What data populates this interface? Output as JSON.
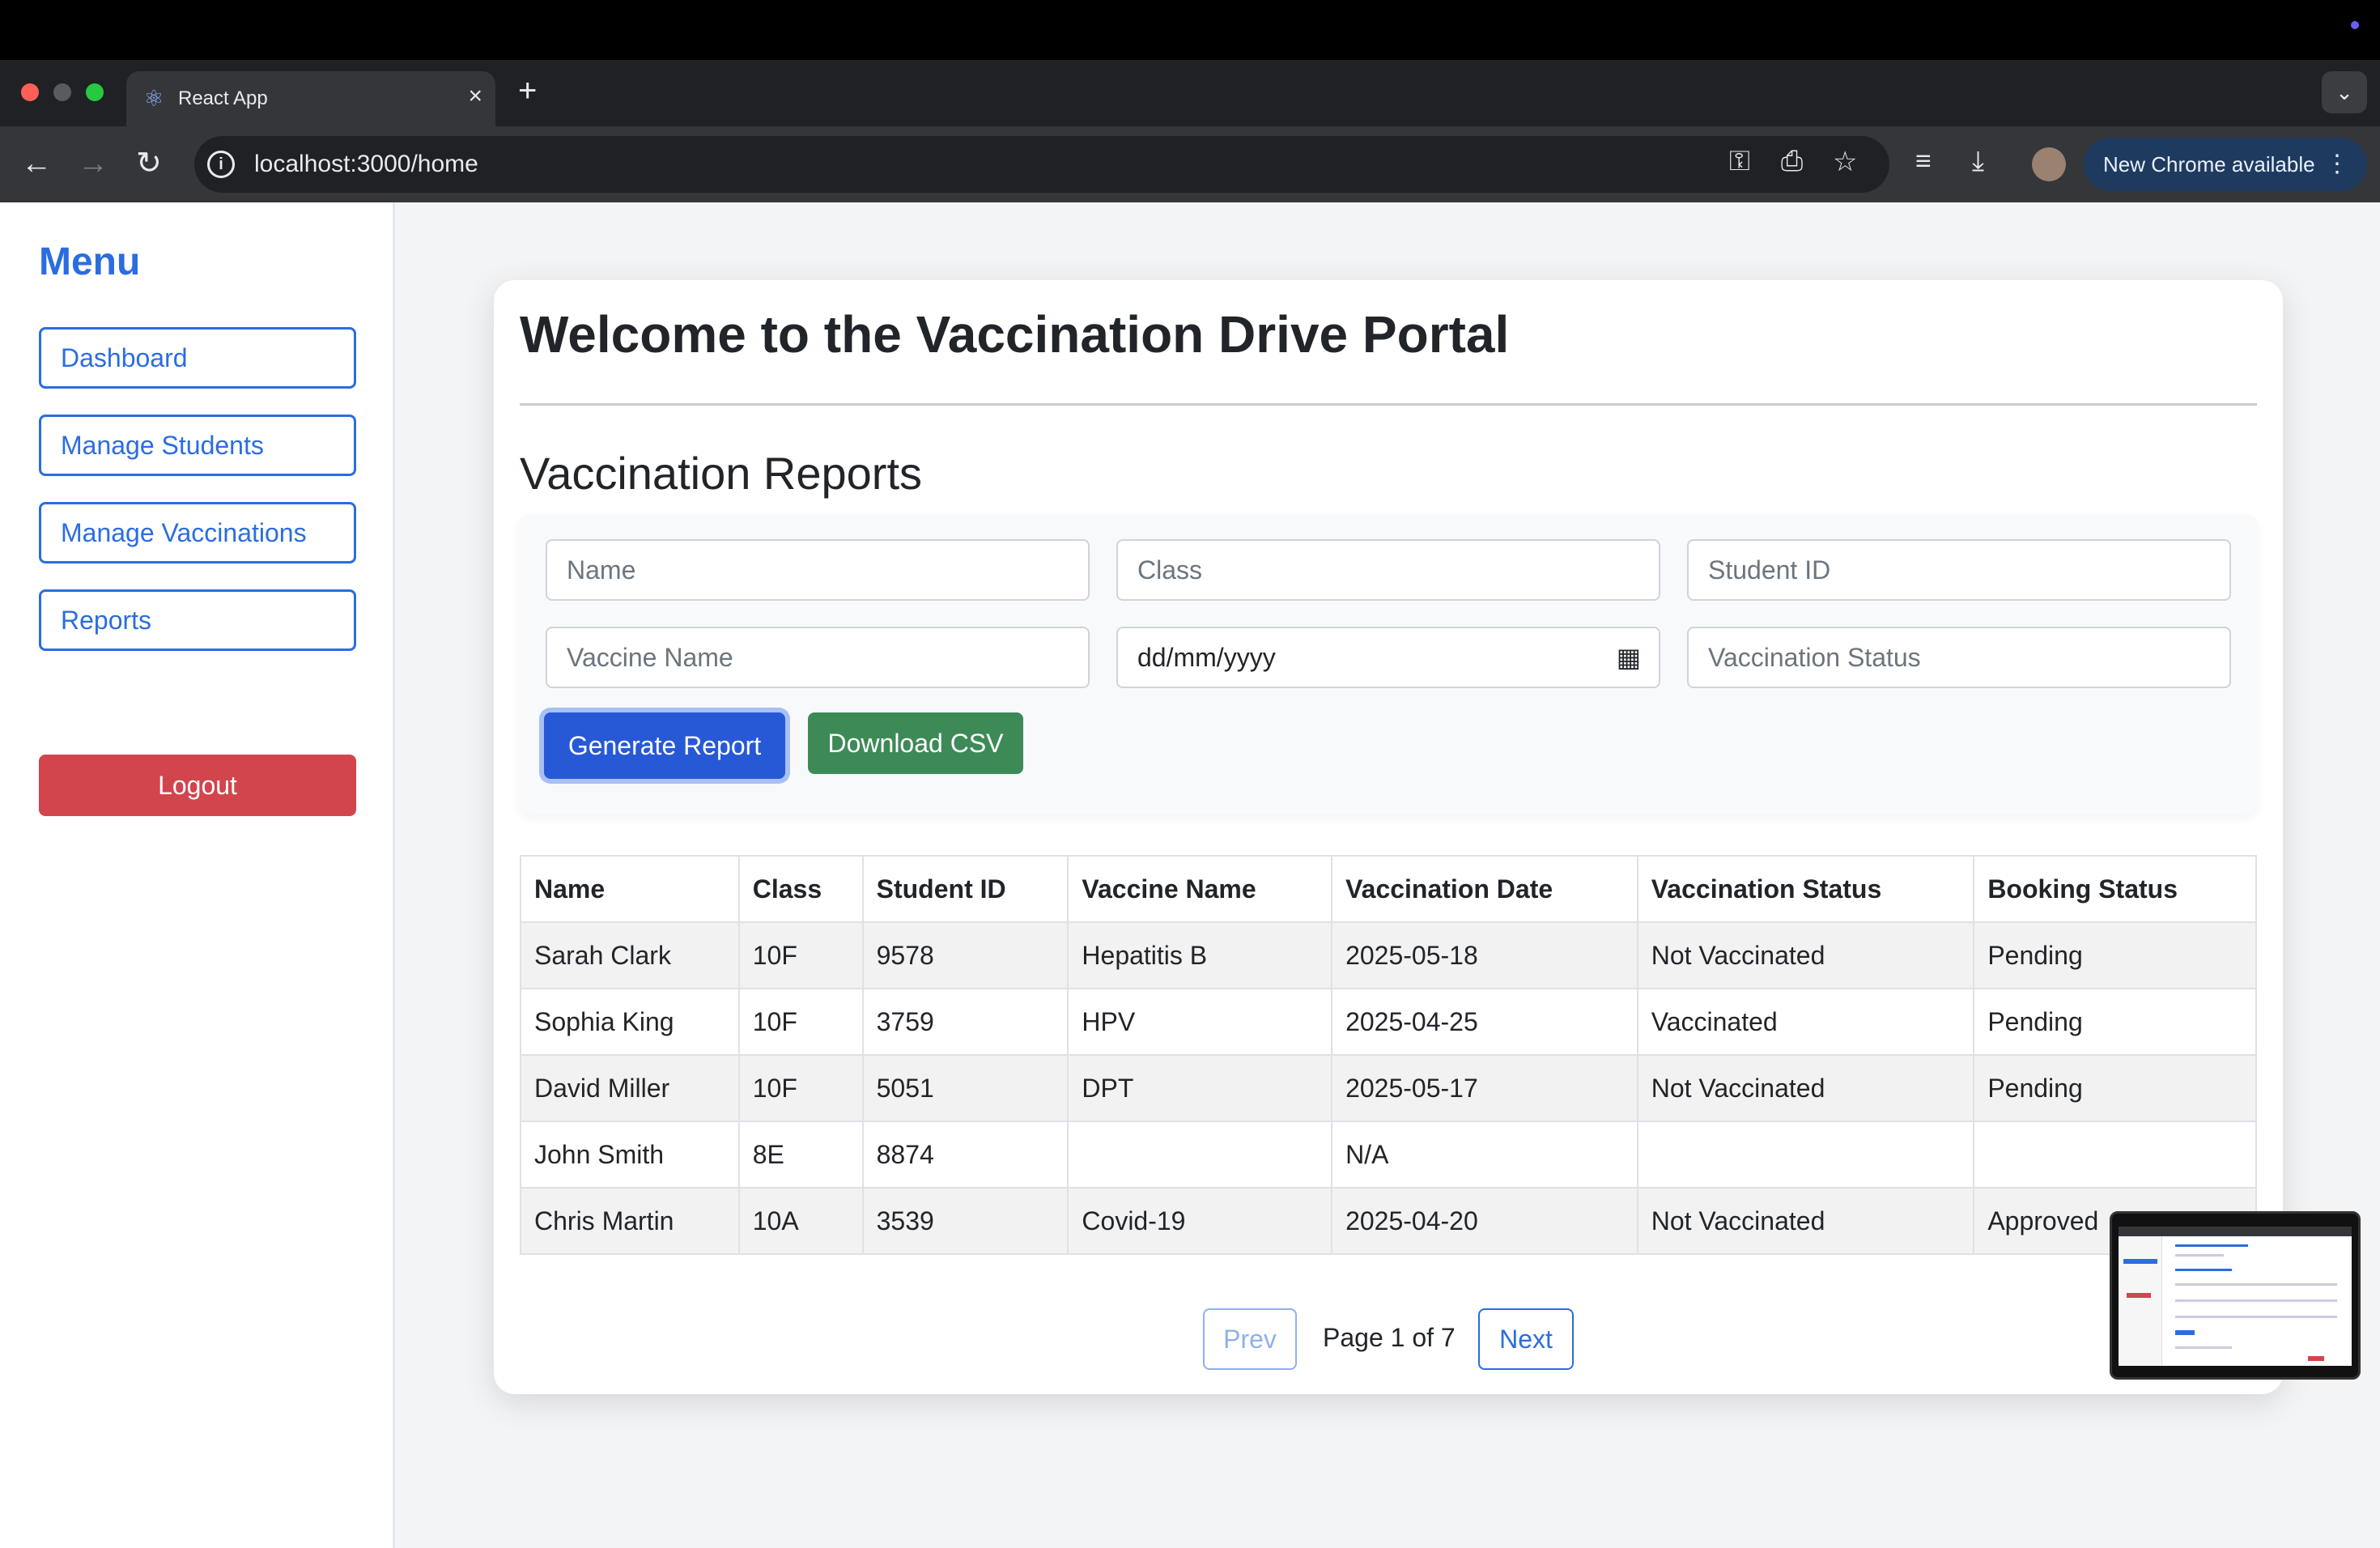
{
  "browser": {
    "tab_title": "React App",
    "url": "localhost:3000/home",
    "update_label": "New Chrome available"
  },
  "sidebar": {
    "title": "Menu",
    "items": [
      {
        "label": "Dashboard"
      },
      {
        "label": "Manage Students"
      },
      {
        "label": "Manage Vaccinations"
      },
      {
        "label": "Reports"
      }
    ],
    "logout_label": "Logout"
  },
  "main": {
    "heading": "Welcome to the Vaccination Drive Portal",
    "subheading": "Vaccination Reports",
    "filters": {
      "name_placeholder": "Name",
      "class_placeholder": "Class",
      "student_id_placeholder": "Student ID",
      "vaccine_name_placeholder": "Vaccine Name",
      "date_value": "dd/mm/yyyy",
      "status_placeholder": "Vaccination Status"
    },
    "generate_label": "Generate Report",
    "download_label": "Download CSV",
    "table": {
      "headers": [
        "Name",
        "Class",
        "Student ID",
        "Vaccine Name",
        "Vaccination Date",
        "Vaccination Status",
        "Booking Status"
      ],
      "rows": [
        [
          "Sarah Clark",
          "10F",
          "9578",
          "Hepatitis B",
          "2025-05-18",
          "Not Vaccinated",
          "Pending"
        ],
        [
          "Sophia King",
          "10F",
          "3759",
          "HPV",
          "2025-04-25",
          "Vaccinated",
          "Pending"
        ],
        [
          "David Miller",
          "10F",
          "5051",
          "DPT",
          "2025-05-17",
          "Not Vaccinated",
          "Pending"
        ],
        [
          "John Smith",
          "8E",
          "8874",
          "",
          "N/A",
          "",
          ""
        ],
        [
          "Chris Martin",
          "10A",
          "3539",
          "Covid-19",
          "2025-04-20",
          "Not Vaccinated",
          "Approved"
        ]
      ]
    },
    "pagination": {
      "prev_label": "Prev",
      "page_text": "Page 1 of 7",
      "next_label": "Next"
    }
  },
  "colors": {
    "accent": "#2b6de0",
    "danger": "#d2454c",
    "success": "#3d8a57"
  }
}
